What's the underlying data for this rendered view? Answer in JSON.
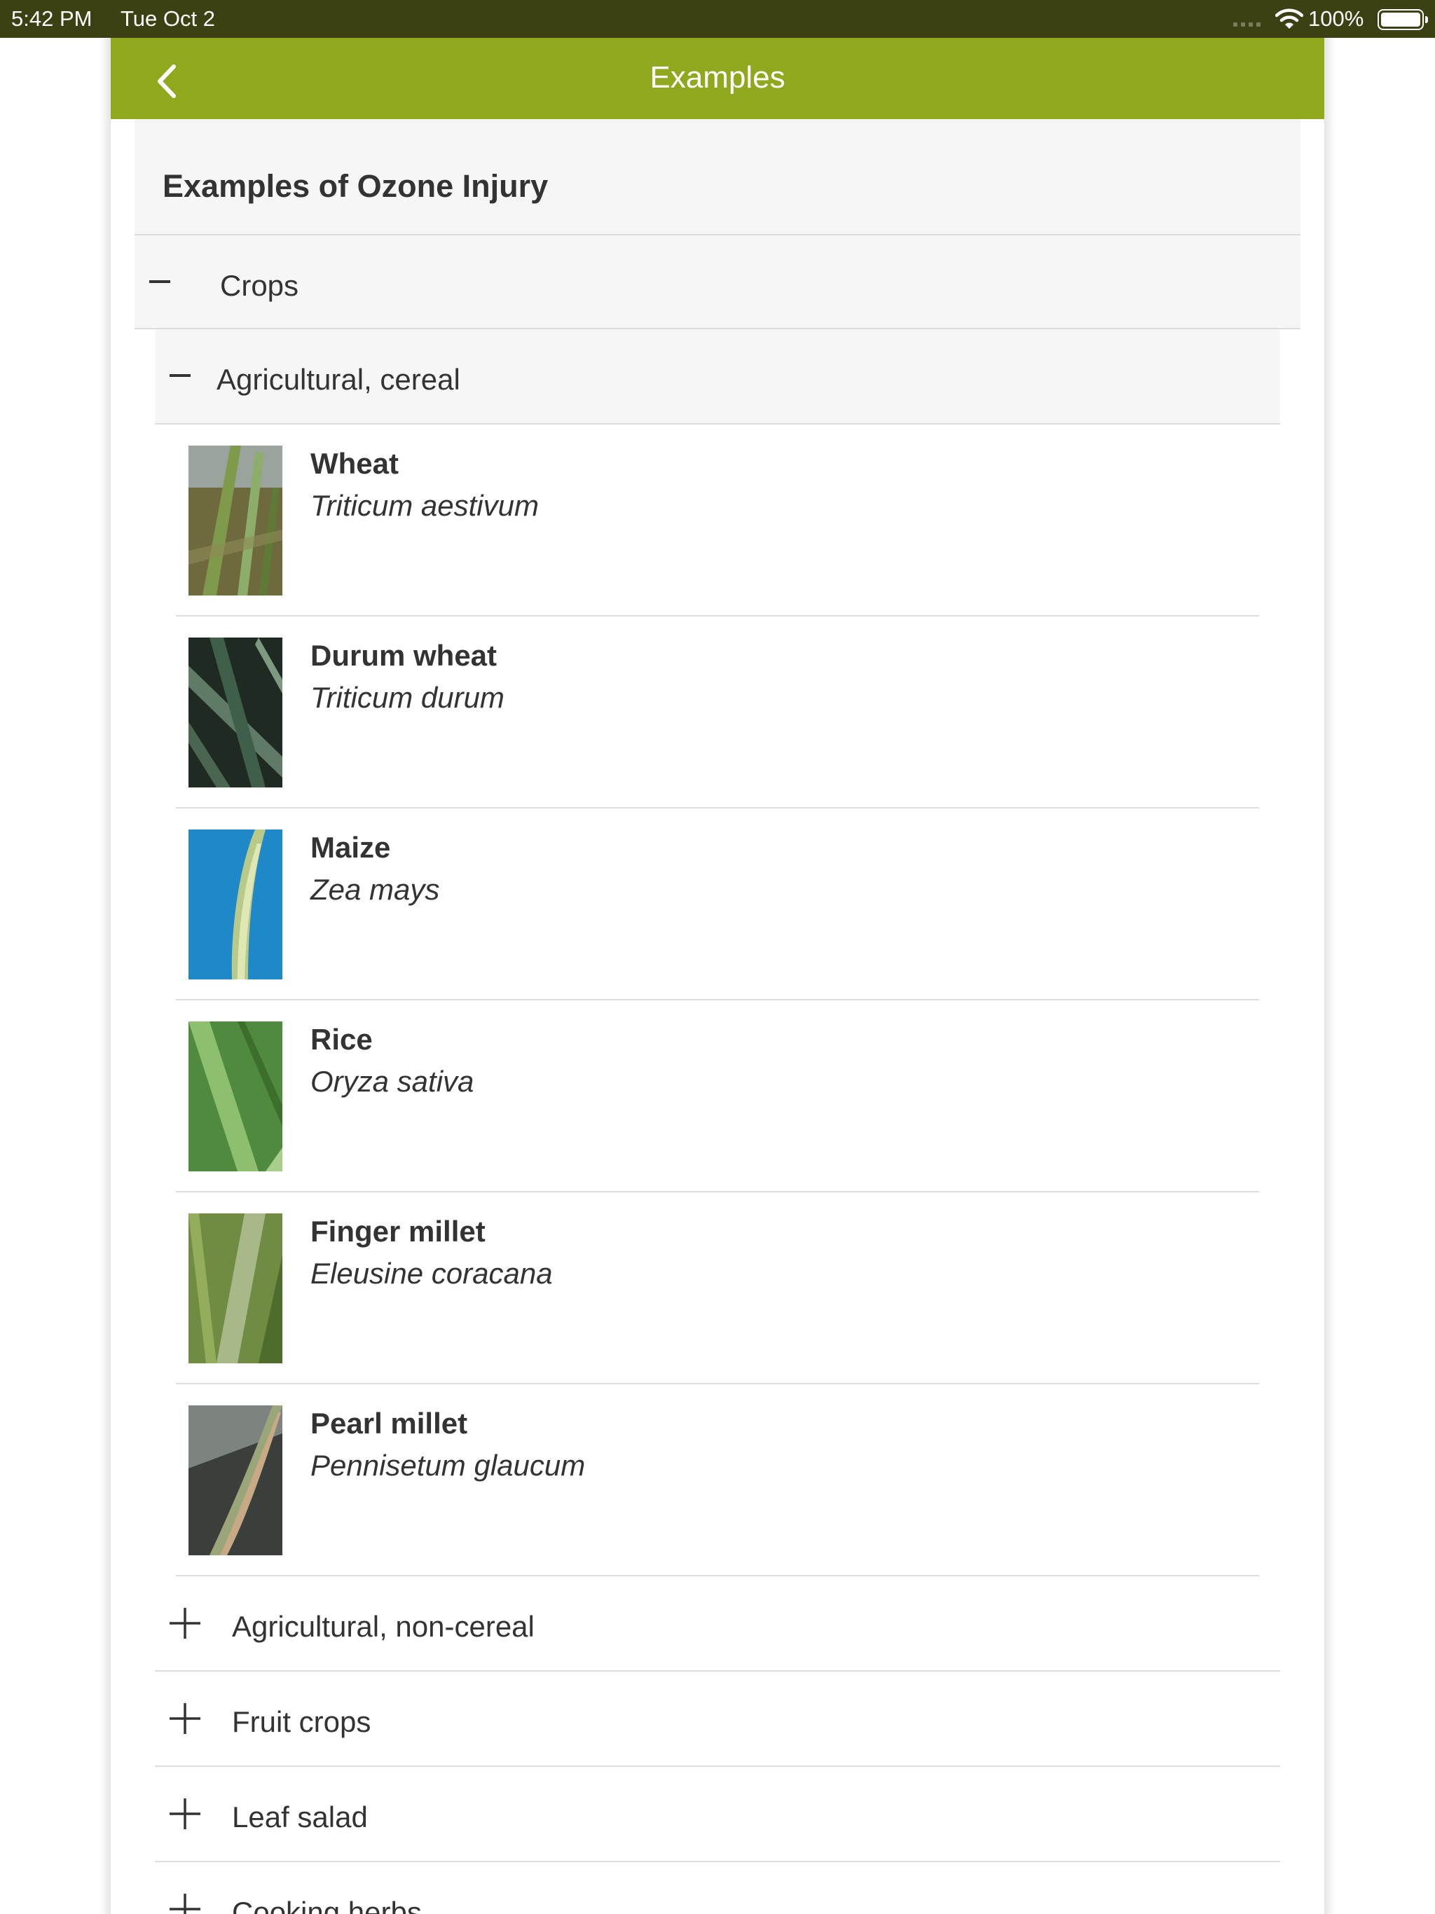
{
  "status": {
    "time": "5:42 PM",
    "date": "Tue Oct 2",
    "battery": "100%"
  },
  "nav": {
    "title": "Examples"
  },
  "heading": "Examples of Ozone Injury",
  "sections": {
    "crops": "Crops",
    "cereal": "Agricultural, cereal"
  },
  "items": [
    {
      "name": "Wheat",
      "sci": "Triticum aestivum"
    },
    {
      "name": "Durum wheat",
      "sci": "Triticum durum"
    },
    {
      "name": "Maize",
      "sci": "Zea mays"
    },
    {
      "name": "Rice",
      "sci": "Oryza sativa"
    },
    {
      "name": "Finger millet",
      "sci": "Eleusine coracana"
    },
    {
      "name": "Pearl millet",
      "sci": "Pennisetum glaucum"
    }
  ],
  "subcategories": [
    "Agricultural, non-cereal",
    "Fruit crops",
    "Leaf salad",
    "Cooking herbs"
  ],
  "colors": {
    "navbar": "#8fa81d",
    "statusbar": "#3d4012"
  }
}
